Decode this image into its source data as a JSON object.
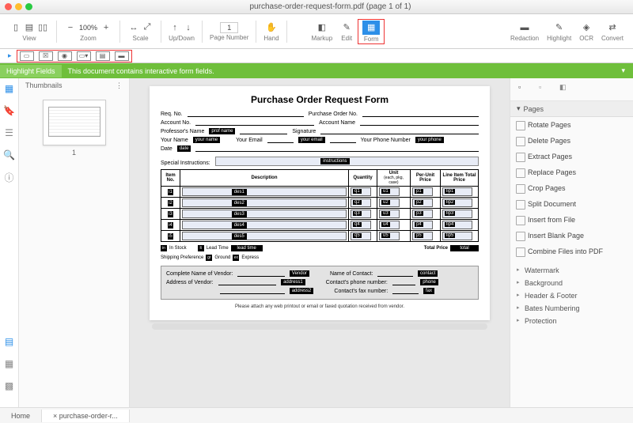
{
  "window": {
    "title": "purchase-order-request-form.pdf (page 1 of 1)"
  },
  "toolbar": {
    "view": "View",
    "zoom": "Zoom",
    "zoom_val": "100%",
    "scale": "Scale",
    "updown": "Up/Down",
    "pagenum": "Page Number",
    "pagenum_val": "1",
    "hand": "Hand",
    "markup": "Markup",
    "edit": "Edit",
    "form": "Form",
    "redaction": "Redaction",
    "highlight": "Highlight",
    "ocr": "OCR",
    "convert": "Convert"
  },
  "banner": {
    "btn": "Highlight Fields",
    "msg": "This document contains interactive form fields."
  },
  "thumbs": {
    "header": "Thumbnails",
    "num": "1"
  },
  "form": {
    "title": "Purchase Order Request Form",
    "req_no": "Req. No.",
    "po_no": "Purchase Order No.",
    "acct_no": "Account No.",
    "acct_name": "Account Name",
    "prof_name": "Professor's Name",
    "prof_val": "prof name",
    "signature": "Signature",
    "your_name": "Your Name",
    "your_name_val": "your name",
    "your_email": "Your Email",
    "your_email_val": "your email",
    "your_phone": "Your Phone Number",
    "your_phone_val": "your phone",
    "date": "Date",
    "date_val": "date",
    "special": "Special Instructions:",
    "special_val": "instructions",
    "cols": {
      "item": "Item No.",
      "desc": "Description",
      "qty": "Quantity",
      "unit": "Unit",
      "unit_sub": "(each, pkg, case)",
      "pup": "Per-Unit Price",
      "lit": "Line Item Total Price"
    },
    "rows": [
      {
        "i": "i1",
        "d": "des1",
        "q": "q1",
        "u": "u1",
        "p": "p1",
        "t": "lip1"
      },
      {
        "i": "i2",
        "d": "des2",
        "q": "q2",
        "u": "u2",
        "p": "p2",
        "t": "lip2"
      },
      {
        "i": "i3",
        "d": "des3",
        "q": "q3",
        "u": "u3",
        "p": "p3",
        "t": "lip3"
      },
      {
        "i": "i4",
        "d": "des4",
        "q": "q4",
        "u": "u4",
        "p": "p4",
        "t": "lip4"
      },
      {
        "i": "i5",
        "d": "des5",
        "q": "q5",
        "u": "u5",
        "p": "p5",
        "t": "lip5"
      }
    ],
    "instock": "In Stock",
    "leadtime": "Lead Time",
    "leadtime_val": "lead time",
    "total": "Total Price",
    "total_val": "total",
    "ship": "Shipping Preference",
    "ground": "Ground",
    "express": "Express",
    "vendor_name": "Complete Name of Vendor:",
    "vendor_val": "Vendor",
    "vendor_addr": "Address of Vendor:",
    "addr1": "address1",
    "addr2": "address2",
    "contact_name": "Name of Contact:",
    "contact_val": "contact",
    "contact_phone": "Contact's phone number:",
    "phone_val": "phone",
    "contact_fax": "Contact's fax number:",
    "fax_val": "fax",
    "footer": "Please attach any web printout or email or faxed quotation received from vendor."
  },
  "rpanel": {
    "header": "Pages",
    "items": [
      "Rotate Pages",
      "Delete Pages",
      "Extract Pages",
      "Replace Pages",
      "Crop Pages",
      "Split Document",
      "Insert from File",
      "Insert Blank Page",
      "Combine Files into PDF"
    ],
    "subs": [
      "Watermark",
      "Background",
      "Header & Footer",
      "Bates Numbering",
      "Protection"
    ]
  },
  "tabs": {
    "home": "Home",
    "doc": "purchase-order-r..."
  }
}
